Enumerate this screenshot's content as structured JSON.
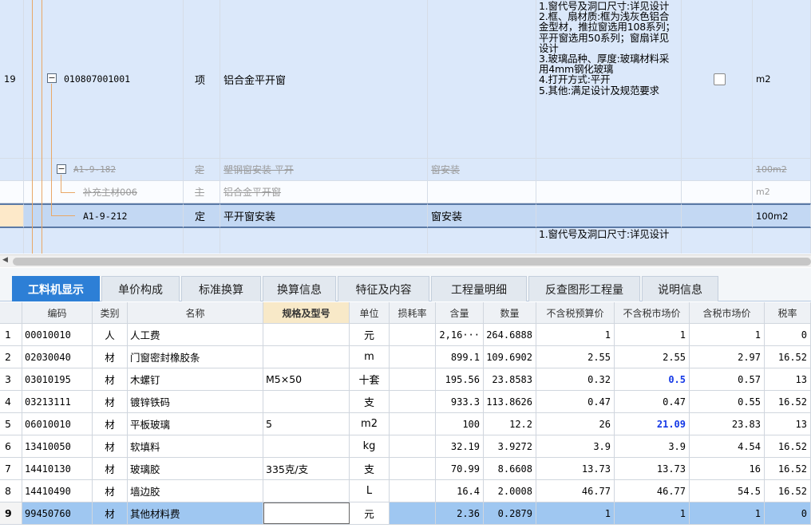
{
  "top_grid": {
    "row19": {
      "num": "19",
      "code": "010807001001",
      "type": "项",
      "name": "铝合金平开窗",
      "desc": "1.窗代号及洞口尺寸:详见设计\n2.框、扇材质:框为浅灰色铝合金型材，推拉窗选用108系列；平开窗选用50系列；窗扇详见设计\n3.玻璃品种、厚度:玻璃材料采用4mm钢化玻璃\n4.打开方式:平开\n5.其他:满足设计及规范要求",
      "unit": "m2",
      "checkbox_checked": false
    },
    "row_a": {
      "code": "A1-9-182",
      "type": "定",
      "name": "塑钢窗安装 平开",
      "feature": "窗安装",
      "unit": "100m2"
    },
    "row_b": {
      "code": "补充主材006",
      "type": "主",
      "name": "铝合金平开窗",
      "unit": "m2"
    },
    "row_c": {
      "code": "A1-9-212",
      "type": "定",
      "name": "平开窗安装",
      "feature": "窗安装",
      "unit": "100m2"
    },
    "row_next": {
      "desc": "1.窗代号及洞口尺寸:详见设计"
    }
  },
  "tabs": [
    {
      "label": "工料机显示",
      "active": true
    },
    {
      "label": "单价构成"
    },
    {
      "label": "标准换算"
    },
    {
      "label": "换算信息"
    },
    {
      "label": "特征及内容"
    },
    {
      "label": "工程量明细"
    },
    {
      "label": "反查图形工程量"
    },
    {
      "label": "说明信息"
    }
  ],
  "table": {
    "headers": [
      "",
      "编码",
      "类别",
      "名称",
      "规格及型号",
      "单位",
      "损耗率",
      "含量",
      "数量",
      "不含税预算价",
      "不含税市场价",
      "含税市场价",
      "税率"
    ],
    "rows": [
      [
        "1",
        "00010010",
        "人",
        "人工费",
        "",
        "元",
        "",
        "2,16···",
        "264.6888",
        "1",
        "1",
        "1",
        "0"
      ],
      [
        "2",
        "02030040",
        "材",
        "门窗密封橡胶条",
        "",
        "m",
        "",
        "899.1",
        "109.6902",
        "2.55",
        "2.55",
        "2.97",
        "16.52"
      ],
      [
        "3",
        "03010195",
        "材",
        "木螺钉",
        "M5×50",
        "十套",
        "",
        "195.56",
        "23.8583",
        "0.32",
        "0.5",
        "0.57",
        "13"
      ],
      [
        "4",
        "03213111",
        "材",
        "镀锌铁码",
        "",
        "支",
        "",
        "933.3",
        "113.8626",
        "0.47",
        "0.47",
        "0.55",
        "16.52"
      ],
      [
        "5",
        "06010010",
        "材",
        "平板玻璃",
        "5",
        "m2",
        "",
        "100",
        "12.2",
        "26",
        "21.09",
        "23.83",
        "13"
      ],
      [
        "6",
        "13410050",
        "材",
        "软填料",
        "",
        "kg",
        "",
        "32.19",
        "3.9272",
        "3.9",
        "3.9",
        "4.54",
        "16.52"
      ],
      [
        "7",
        "14410130",
        "材",
        "玻璃胶",
        "335克/支",
        "支",
        "",
        "70.99",
        "8.6608",
        "13.73",
        "13.73",
        "16",
        "16.52"
      ],
      [
        "8",
        "14410490",
        "材",
        "墙边胶",
        "",
        "L",
        "",
        "16.4",
        "2.0008",
        "46.77",
        "46.77",
        "54.5",
        "16.52"
      ],
      [
        "9",
        "99450760",
        "材",
        "其他材料费",
        "",
        "元",
        "",
        "2.36",
        "0.2879",
        "1",
        "1",
        "1",
        "0"
      ]
    ],
    "highlight_color": "#1438e6"
  }
}
